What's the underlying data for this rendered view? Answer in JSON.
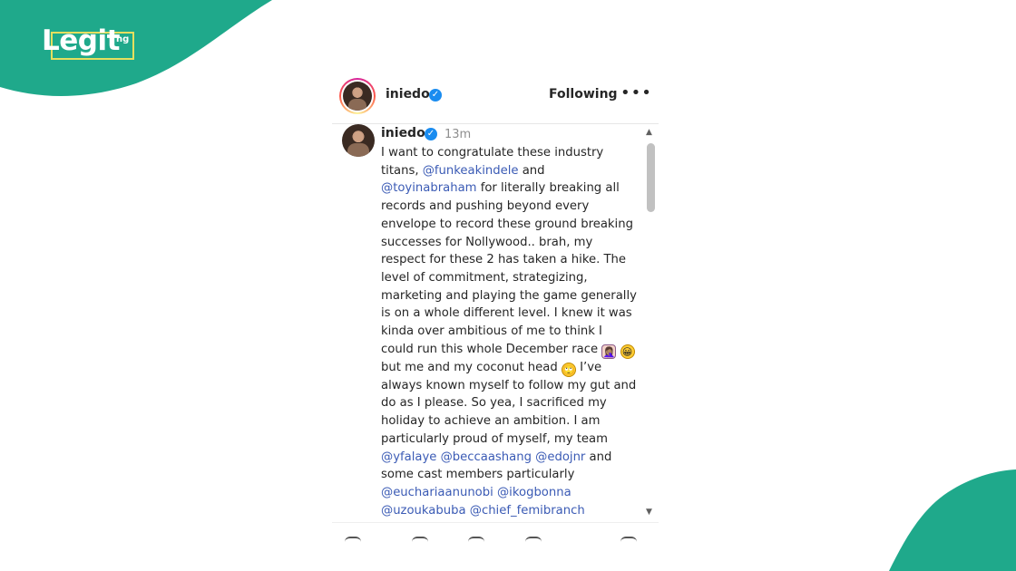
{
  "brand": {
    "logo_text": "Legit",
    "logo_suffix": "ng",
    "green": "#1fa98b",
    "accent_yellow": "#e6df5e"
  },
  "post": {
    "header": {
      "username": "iniedo",
      "verified_icon": "verified-badge-icon",
      "follow_label": "Following",
      "more_icon": "more-options-icon"
    },
    "caption": {
      "username": "iniedo",
      "time": "13m",
      "segments": [
        {
          "t": "text",
          "v": "I want to congratulate these industry titans, "
        },
        {
          "t": "mention",
          "v": "@funkeakindele"
        },
        {
          "t": "text",
          "v": " and "
        },
        {
          "t": "mention",
          "v": "@toyinabraham"
        },
        {
          "t": "text",
          "v": " for literally breaking all records and pushing beyond every envelope to record these ground breaking successes for Nollywood.. brah, my respect for these 2 has taken a hike. The level of commitment, strategizing, marketing and playing the game generally is on a whole different level. I knew it was kinda over ambitious of me to think I could run this whole December race "
        },
        {
          "t": "emoji",
          "v": "🤦🏽‍♀️",
          "name": "facepalm-emoji"
        },
        {
          "t": "text",
          "v": " "
        },
        {
          "t": "emoji",
          "v": "😀",
          "name": "grinning-emoji"
        },
        {
          "t": "text",
          "v": " but me and my coconut head "
        },
        {
          "t": "emoji",
          "v": "🙄",
          "name": "eye-roll-emoji"
        },
        {
          "t": "text",
          "v": " I’ve always known myself to follow my gut and do as I please. So yea, I sacrificed my holiday to achieve an ambition. I am particularly proud of myself, my team "
        },
        {
          "t": "mention",
          "v": "@yfalaye"
        },
        {
          "t": "text",
          "v": " "
        },
        {
          "t": "mention",
          "v": "@beccaashang"
        },
        {
          "t": "text",
          "v": " "
        },
        {
          "t": "mention",
          "v": "@edojnr"
        },
        {
          "t": "text",
          "v": " and some cast members particularly "
        },
        {
          "t": "mention",
          "v": "@euchariaanunobi"
        },
        {
          "t": "text",
          "v": " "
        },
        {
          "t": "mention",
          "v": "@ikogbonna"
        },
        {
          "t": "text",
          "v": " "
        },
        {
          "t": "mention",
          "v": "@uzoukabuba"
        },
        {
          "t": "text",
          "v": " "
        },
        {
          "t": "mention",
          "v": "@chief_femibranch"
        }
      ]
    }
  }
}
